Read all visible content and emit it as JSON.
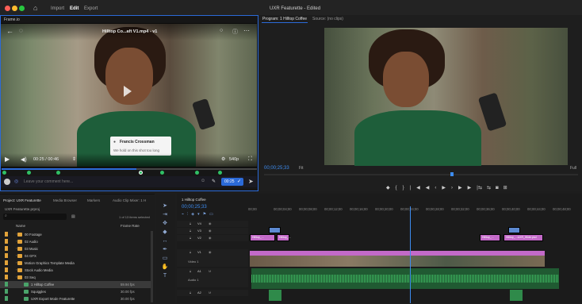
{
  "app": {
    "title": "UXR Featurette - Edited",
    "menu": [
      "Import",
      "Edit",
      "Export"
    ],
    "active_menu": "Edit"
  },
  "frameio": {
    "panel_title": "Frame.io",
    "clip_title": "Hilltop Co...aft V1.mp4 - v1",
    "timecode": "00:25 / 00:46",
    "quality": "540p",
    "commenter_name": "Francis Crossman",
    "comment_text": "We hold on this shot too long",
    "comment_placeholder": "Leave your comment here...",
    "comment_time": "00:25"
  },
  "program": {
    "tab_program": "Program: 1 Hilltop Coffee",
    "tab_source": "Source: (no clips)",
    "timecode": "00;00;25;33",
    "fit_label": "Fit",
    "full_label": "Full"
  },
  "project": {
    "tabs": [
      "Project: UXR Featurette",
      "Media Browser",
      "Markers",
      "Audio Clip Mixer: 1 H"
    ],
    "file": "UXR Featurette.prproj",
    "items_selected": "1 of 13 items selected",
    "col_name": "Name",
    "col_framerate": "Frame Rate",
    "items": [
      {
        "name": "00 Footage",
        "type": "folder",
        "rate": ""
      },
      {
        "name": "02 Audio",
        "type": "folder",
        "rate": ""
      },
      {
        "name": "03 Music",
        "type": "folder",
        "rate": ""
      },
      {
        "name": "04 GFX",
        "type": "folder",
        "rate": ""
      },
      {
        "name": "Motion Graphics Template Media",
        "type": "folder",
        "rate": ""
      },
      {
        "name": "Stock Audio Media",
        "type": "folder",
        "rate": ""
      },
      {
        "name": "03 Seq",
        "type": "folder",
        "rate": ""
      },
      {
        "name": "1 Hilltop Coffee",
        "type": "seq",
        "rate": "59.94 fps"
      },
      {
        "name": "Squiggles",
        "type": "seq",
        "rate": "30.00 fps"
      },
      {
        "name": "UXR Export Mode Featurette",
        "type": "seq",
        "rate": "30.00 fps"
      }
    ]
  },
  "timeline": {
    "tab": "1 Hilltop Coffee",
    "timecode": "00;00;25;33",
    "ruler": [
      "00;00",
      "00;00;04;00",
      "00;00;08;00",
      "00;00;12;00",
      "00;00;16;00",
      "00;00;20;00",
      "00;00;24;00",
      "00;00;28;00",
      "00;00;32;00",
      "00;00;36;00",
      "00;00;40;00",
      "00;00;44;00",
      "00;00;48;00"
    ],
    "tracks": [
      "V4",
      "V3",
      "V2",
      "V1",
      "A1",
      "A2"
    ],
    "video1_label": "Video 1",
    "audio1_label": "Audio 1",
    "clip_labels": [
      "Hilltop_...",
      "Hilltop_...",
      "Hilltop_...UXR_Wide.psd",
      "Hilltop_...",
      "Hilltop_..."
    ]
  },
  "colors": {
    "accent": "#2b6ad8",
    "playhead": "#3d8cf0",
    "comment_green": "#30c065"
  }
}
